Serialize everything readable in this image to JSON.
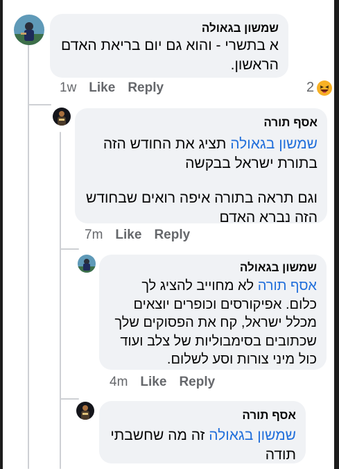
{
  "comments": [
    {
      "author": "שמשון בגאולה",
      "text": "א בתשרי - והוא גם יום בריאת האדם הראשון.",
      "time": "1w",
      "like_label": "Like",
      "reply_label": "Reply",
      "reaction_count": "2",
      "reaction_icon": "laughing-face-emoji"
    },
    {
      "author": "אסף תורה",
      "mention": "שמשון בגאולה",
      "text": "תציג את החודש הזה בתורת ישראל בבקשה",
      "text2": "וגם תראה בתורה איפה רואים שבחודש הזה נברא האדם",
      "time": "7m",
      "like_label": "Like",
      "reply_label": "Reply"
    },
    {
      "author": "שמשון בגאולה",
      "mention": "אסף תורה",
      "text": "לא מחוייב להציג לך כלום. אפיקורסים וכופרים יוצאים מכלל ישראל, קח את הפסוקים שלך שכתובים בסימבוליות של צלב ועוד כול מיני צורות וסע לשלום.",
      "time": "4m",
      "like_label": "Like",
      "reply_label": "Reply"
    },
    {
      "author": "אסף תורה",
      "mention": "שמשון בגאולה",
      "text": "זה מה שחשבתי תודה"
    }
  ]
}
